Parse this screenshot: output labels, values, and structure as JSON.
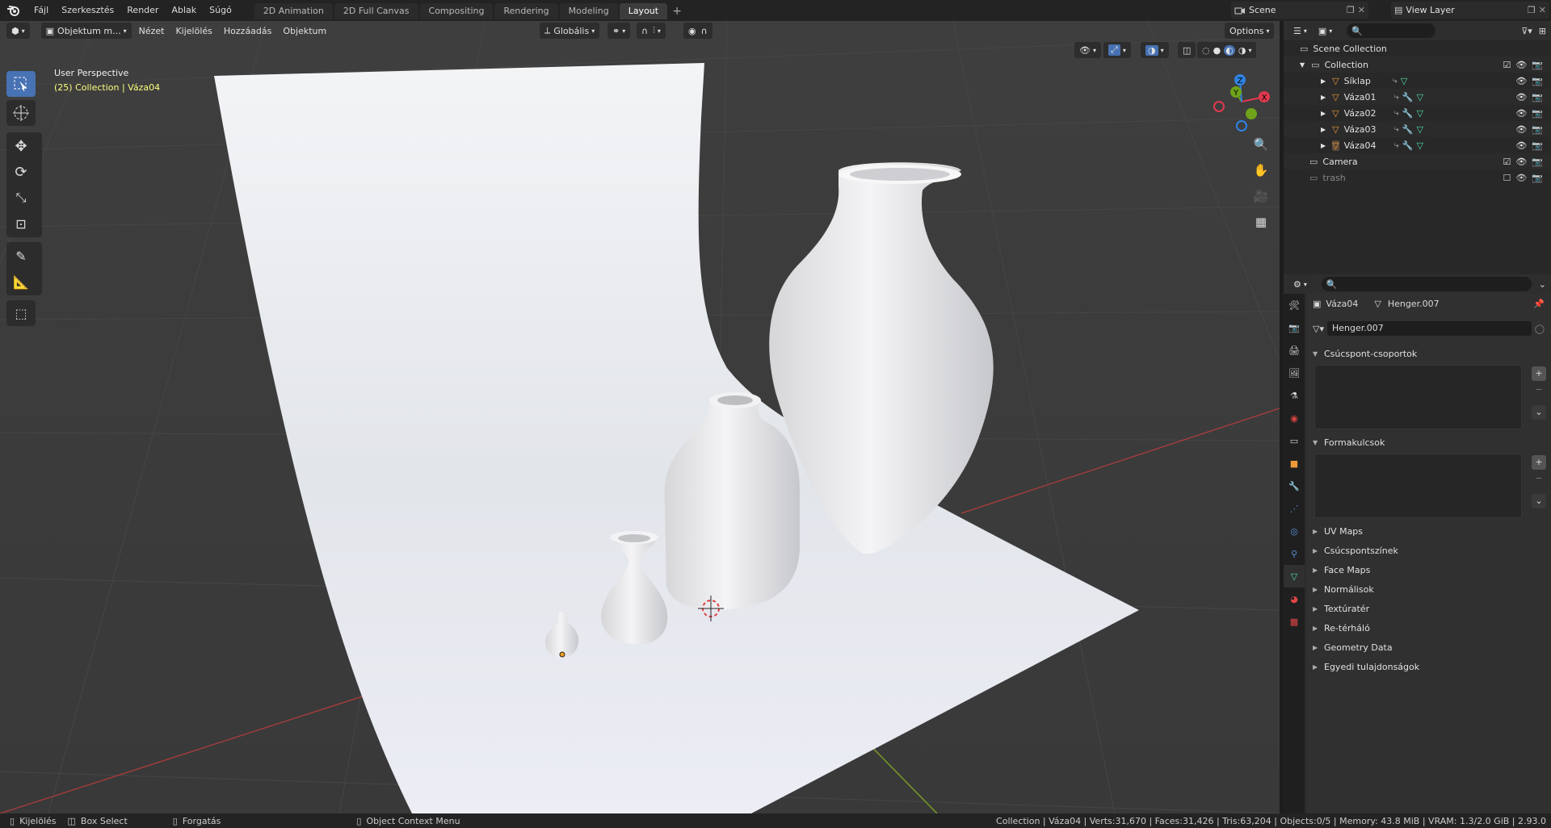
{
  "topbar": {
    "menus": [
      "Fájl",
      "Szerkesztés",
      "Render",
      "Ablak",
      "Súgó"
    ],
    "workspaces": [
      "2D Animation",
      "2D Full Canvas",
      "Compositing",
      "Rendering",
      "Modeling",
      "Layout"
    ],
    "active_workspace": "Layout",
    "scene": "Scene",
    "view_layer": "View Layer"
  },
  "viewport": {
    "mode": "Objektum m...",
    "menus": [
      "Nézet",
      "Kijelölés",
      "Hozzáadás",
      "Objektum"
    ],
    "orientation": "Globális",
    "options": "Options",
    "perspective": "User Perspective",
    "collection_info": "(25) Collection | Váza04",
    "gizmo_axes": {
      "x": "X",
      "y": "Y",
      "z": "Z"
    }
  },
  "outliner": {
    "scene_collection": "Scene Collection",
    "collection": "Collection",
    "items": [
      "Síklap",
      "Váza01",
      "Váza02",
      "Váza03",
      "Váza04"
    ],
    "camera": "Camera",
    "trash": "trash"
  },
  "properties": {
    "object_name": "Váza04",
    "mesh_name": "Henger.007",
    "data_field": "Henger.007",
    "sections_open": [
      "Csúcspont-csoportok",
      "Formakulcsok"
    ],
    "sections_closed": [
      "UV Maps",
      "Csúcspontszínek",
      "Face Maps",
      "Normálisok",
      "Textúratér",
      "Re-térháló",
      "Geometry Data",
      "Egyedi tulajdonságok"
    ]
  },
  "statusbar": {
    "select": "Kijelölés",
    "box_select": "Box Select",
    "rotate": "Forgatás",
    "context_menu": "Object Context Menu",
    "stats": "Collection | Váza04 | Verts:31,670 | Faces:31,426 | Tris:63,204 | Objects:0/5 | Memory: 43.8 MiB | VRAM: 1.3/2.0 GiB | 2.93.0"
  },
  "colors": {
    "accent": "#4772b3",
    "header_text": "#ffff80",
    "mesh_icon": "#4be0a0",
    "object_icon": "#ee9a3a",
    "axis_x": "#e0394f",
    "axis_y": "#6ea31a",
    "axis_z": "#2f83e3"
  }
}
